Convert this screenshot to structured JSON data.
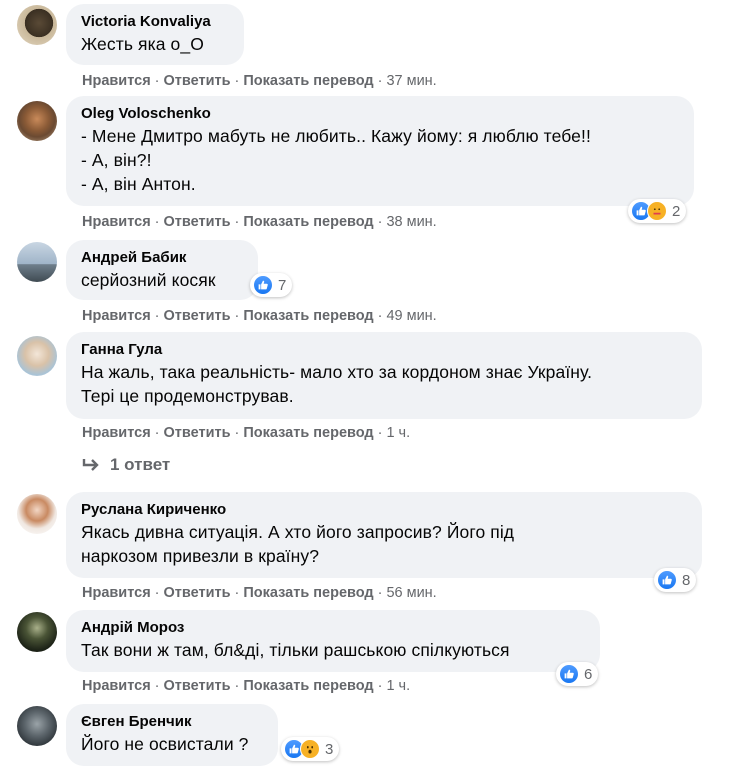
{
  "actions": {
    "like": "Нравится",
    "reply": "Ответить",
    "translate": "Показать перевод"
  },
  "comments": [
    {
      "author": "Victoria Konvaliya",
      "lines": [
        "Жесть яка о_О"
      ],
      "time": "37 мин.",
      "reactions": null
    },
    {
      "author": "Oleg Voloschenko",
      "lines": [
        "- Мене Дмитро мабуть не любить.. Кажу йому: я люблю тебе!!",
        "- А, він?!",
        "- А, він Антон."
      ],
      "time": "38 мин.",
      "reactions": {
        "types": [
          "like",
          "care"
        ],
        "count": "2"
      }
    },
    {
      "author": "Андрей Бабик",
      "lines": [
        "серйозний косяк"
      ],
      "time": "49 мин.",
      "reactions": {
        "types": [
          "like"
        ],
        "count": "7"
      }
    },
    {
      "author": "Ганна Гула",
      "lines": [
        "На жаль, така реальність- мало хто за кордоном знає Україну.",
        "Тері це продемонстрував."
      ],
      "time": "1 ч.",
      "reactions": null
    },
    {
      "author": "Руслана Кириченко",
      "lines": [
        "Якась дивна ситуація. А хто його запросив? Його під",
        "наркозом привезли в країну?"
      ],
      "time": "56 мин.",
      "reactions": {
        "types": [
          "like"
        ],
        "count": "8"
      }
    },
    {
      "author": "Андрій Мороз",
      "lines": [
        "Так вони ж там, бл&ді, тільки рашською спілкуються"
      ],
      "time": "1 ч.",
      "reactions": {
        "types": [
          "like"
        ],
        "count": "6"
      }
    },
    {
      "author": "Євген Бренчик",
      "lines": [
        "Його не освистали ?"
      ],
      "reactions": {
        "types": [
          "like",
          "wow"
        ],
        "count": "3"
      }
    }
  ],
  "replies": {
    "label": "1 ответ"
  },
  "colors": {
    "bubble": "#f0f2f5",
    "meta": "#65676b",
    "like": "#1877f2",
    "care": "#f7b125"
  }
}
